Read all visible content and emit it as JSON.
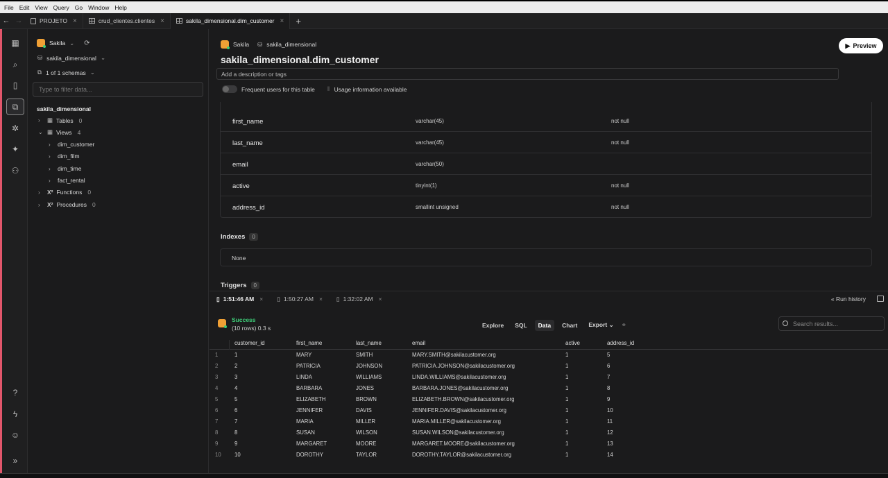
{
  "menu": [
    "File",
    "Edit",
    "View",
    "Query",
    "Go",
    "Window",
    "Help"
  ],
  "tabs": [
    {
      "label": "PROJETO"
    },
    {
      "label": "crud_clientes.clientes"
    },
    {
      "label": "sakila_dimensional.dim_customer"
    }
  ],
  "sidebar": {
    "connection": "Sakila",
    "database": "sakila_dimensional",
    "schemas": "1 of 1 schemas",
    "filter_placeholder": "Type to filter data...",
    "schema_title": "sakila_dimensional",
    "tables": {
      "label": "Tables",
      "count": "0"
    },
    "views": {
      "label": "Views",
      "count": "4",
      "items": [
        "dim_customer",
        "dim_film",
        "dim_time",
        "fact_rental"
      ]
    },
    "functions": {
      "label": "Functions",
      "count": "0"
    },
    "procedures": {
      "label": "Procedures",
      "count": "0"
    }
  },
  "main": {
    "breadcrumb_conn": "Sakila",
    "breadcrumb_db": "sakila_dimensional",
    "title": "sakila_dimensional.dim_customer",
    "preview": "Preview",
    "description": "Add a description or tags",
    "frequent_users": "Frequent users for this table",
    "usage": "Usage information available",
    "columns": [
      {
        "name": "first_name",
        "type": "varchar(45)",
        "null": "not null"
      },
      {
        "name": "last_name",
        "type": "varchar(45)",
        "null": "not null"
      },
      {
        "name": "email",
        "type": "varchar(50)",
        "null": ""
      },
      {
        "name": "active",
        "type": "tinyint(1)",
        "null": "not null"
      },
      {
        "name": "address_id",
        "type": "smallint unsigned",
        "null": "not null"
      }
    ],
    "indexes": {
      "label": "Indexes",
      "count": "0",
      "none": "None"
    },
    "triggers": {
      "label": "Triggers",
      "count": "0"
    }
  },
  "results": {
    "tabs": [
      "1:51:46 AM",
      "1:50:27 AM",
      "1:32:02 AM"
    ],
    "run_history": "Run history",
    "status": "Success",
    "rows_info": "(10 rows) 0.3 s",
    "views": [
      "Explore",
      "SQL",
      "Data",
      "Chart",
      "Export"
    ],
    "search_placeholder": "Search results...",
    "headers": [
      "customer_id",
      "first_name",
      "last_name",
      "email",
      "active",
      "address_id"
    ],
    "rows": [
      [
        "1",
        "1",
        "MARY",
        "SMITH",
        "MARY.SMITH@sakilacustomer.org",
        "1",
        "5"
      ],
      [
        "2",
        "2",
        "PATRICIA",
        "JOHNSON",
        "PATRICIA.JOHNSON@sakilacustomer.org",
        "1",
        "6"
      ],
      [
        "3",
        "3",
        "LINDA",
        "WILLIAMS",
        "LINDA.WILLIAMS@sakilacustomer.org",
        "1",
        "7"
      ],
      [
        "4",
        "4",
        "BARBARA",
        "JONES",
        "BARBARA.JONES@sakilacustomer.org",
        "1",
        "8"
      ],
      [
        "5",
        "5",
        "ELIZABETH",
        "BROWN",
        "ELIZABETH.BROWN@sakilacustomer.org",
        "1",
        "9"
      ],
      [
        "6",
        "6",
        "JENNIFER",
        "DAVIS",
        "JENNIFER.DAVIS@sakilacustomer.org",
        "1",
        "10"
      ],
      [
        "7",
        "7",
        "MARIA",
        "MILLER",
        "MARIA.MILLER@sakilacustomer.org",
        "1",
        "11"
      ],
      [
        "8",
        "8",
        "SUSAN",
        "WILSON",
        "SUSAN.WILSON@sakilacustomer.org",
        "1",
        "12"
      ],
      [
        "9",
        "9",
        "MARGARET",
        "MOORE",
        "MARGARET.MOORE@sakilacustomer.org",
        "1",
        "13"
      ],
      [
        "10",
        "10",
        "DOROTHY",
        "TAYLOR",
        "DOROTHY.TAYLOR@sakilacustomer.org",
        "1",
        "14"
      ]
    ]
  },
  "colors": {
    "accent": "#3fd07a",
    "brand": "#f0a035",
    "rail_edge": "#e2566b"
  }
}
